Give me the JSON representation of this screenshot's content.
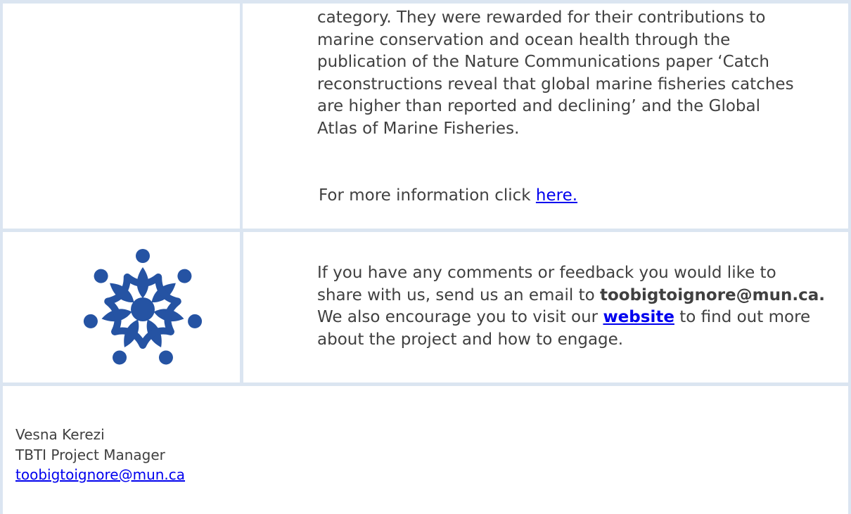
{
  "section1": {
    "lines": [
      "category. They were rewarded for their contributions to",
      "marine conservation and ocean health through the",
      "publication of the Nature Communications paper ‘Catch",
      "reconstructions reveal that global marine fisheries catches",
      "are higher than reported and declining’ and the Global",
      "Atlas of Marine Fisheries."
    ],
    "more_info_prefix": "For more information click ",
    "more_info_link": "here."
  },
  "section2": {
    "line1": "If you have any comments or feedback you would like to",
    "line2_prefix": "share with us, send us an email to ",
    "email_bold": "toobigtoignore@mun.ca.",
    "line3_prefix": "We also encourage you to visit our ",
    "website_link": "website",
    "line3_suffix": " to find out more",
    "line4": "about the project and how to engage."
  },
  "signature": {
    "name": "Vesna Kerezi",
    "title": "TBTI Project Manager",
    "email": "toobigtoignore@mun.ca"
  },
  "colors": {
    "border": "#dbe5f1",
    "logo": "#2553a3",
    "link": "#0000ee"
  }
}
